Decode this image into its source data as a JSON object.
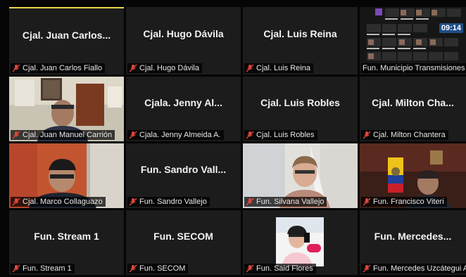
{
  "tiles": [
    {
      "name": "Cjal. Juan Carlos...",
      "label": "Cjal. Juan Carlos Fiallo"
    },
    {
      "name": "Cjal. Hugo Dávila",
      "label": "Cjal. Hugo Dávila"
    },
    {
      "name": "Cjal. Luis Reina",
      "label": "Cjal. Luis Reina"
    },
    {
      "name": "",
      "label": "Fun. Municipio Transmisiones E"
    },
    {
      "name": "",
      "label": "Cjal. Juan Manuel Carrión"
    },
    {
      "name": "Cjala. Jenny Al...",
      "label": "Cjala. Jenny Almeida A."
    },
    {
      "name": "Cjal. Luis Robles",
      "label": "Cjal. Luis Robles"
    },
    {
      "name": "Cjal. Milton Cha...",
      "label": "Cjal. Milton Chantera"
    },
    {
      "name": "",
      "label": "Cjal. Marco Collaguazo"
    },
    {
      "name": "Fun. Sandro Vall...",
      "label": "Fun. Sandro Vallejo"
    },
    {
      "name": "",
      "label": "Fun. Silvana Vallejo"
    },
    {
      "name": "",
      "label": "Fun. Francisco Viteri"
    },
    {
      "name": "Fun. Stream 1",
      "label": "Fun. Stream 1"
    },
    {
      "name": "Fun. SECOM",
      "label": "Fun. SECOM"
    },
    {
      "name": "",
      "label": "Fun. Said Flores"
    },
    {
      "name": "Fun. Mercedes...",
      "label": "Fun. Mercedes Uzcátegui A."
    }
  ],
  "clock": "09:14",
  "icons": {
    "mic": "mic-muted-icon"
  },
  "colors": {
    "tile_bg": "#1c1c1c",
    "active_border": "#e7d84a",
    "mic_muted": "#e0463c"
  }
}
